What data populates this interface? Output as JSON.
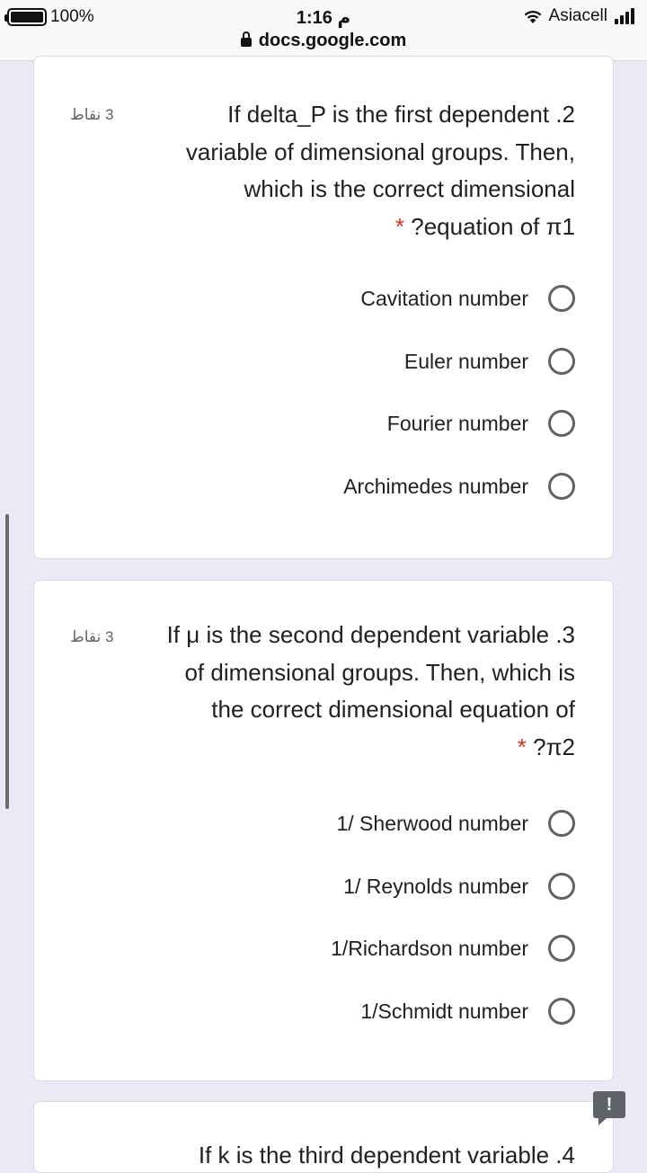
{
  "status_bar": {
    "battery_percent": "100%",
    "battery_level": 1.0,
    "time": "1:16 م",
    "url": "docs.google.com",
    "carrier": "Asiacell",
    "wifi_icon": "wifi-icon",
    "signal_icon": "signal-icon",
    "lock_icon": "lock-icon"
  },
  "questions": [
    {
      "points": "3 نقاط",
      "lines": [
        "If delta_P is the first dependent .2",
        "variable of dimensional groups. Then,",
        "which is the correct dimensional"
      ],
      "last_line": "?equation of π1",
      "required_mark": "*",
      "options": [
        "Cavitation number",
        "Euler number",
        "Fourier number",
        "Archimedes number"
      ]
    },
    {
      "points": "3 نقاط",
      "lines": [
        "If μ is the second dependent variable .3",
        "of dimensional groups. Then, which is",
        "the correct dimensional equation of"
      ],
      "last_line": "?π2",
      "required_mark": "*",
      "options": [
        "1/ Sherwood number",
        "1/ Reynolds number",
        "1/Richardson number",
        "1/Schmidt number"
      ]
    }
  ],
  "next_question_partial": "If k is the third dependent variable .4",
  "report_icon": "report-problem-icon",
  "report_label": "!"
}
